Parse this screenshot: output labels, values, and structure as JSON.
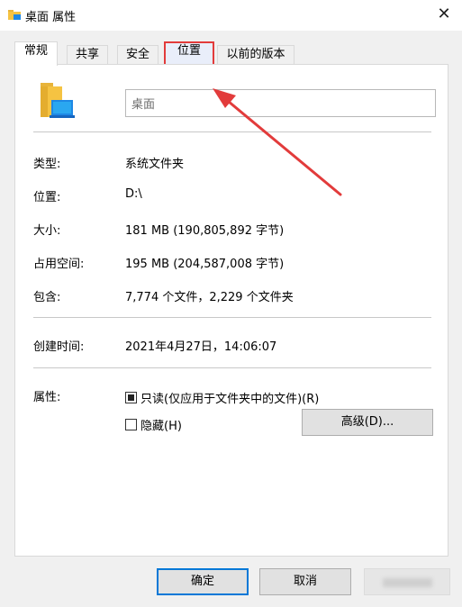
{
  "window": {
    "title": "桌面 属性",
    "close_glyph": "✕"
  },
  "tabs": [
    {
      "label": "常规",
      "active": true
    },
    {
      "label": "共享",
      "active": false
    },
    {
      "label": "安全",
      "active": false
    },
    {
      "label": "位置",
      "active": false,
      "highlighted": true
    },
    {
      "label": "以前的版本",
      "active": false
    }
  ],
  "general": {
    "name": "桌面",
    "properties": [
      {
        "label": "类型:",
        "value": "系统文件夹"
      },
      {
        "label": "位置:",
        "value": "D:\\"
      },
      {
        "label": "大小:",
        "value": "181 MB (190,805,892 字节)"
      },
      {
        "label": "占用空间:",
        "value": "195 MB (204,587,008 字节)"
      },
      {
        "label": "包含:",
        "value": "7,774 个文件，2,229 个文件夹"
      }
    ],
    "created": {
      "label": "创建时间:",
      "value": "2021年4月27日，14:06:07"
    },
    "attributes": {
      "label": "属性:",
      "readonly_label": "只读(仅应用于文件夹中的文件)(R)",
      "readonly_state": "indeterminate",
      "hidden_label": "隐藏(H)",
      "hidden_checked": false,
      "advanced_label": "高级(D)..."
    }
  },
  "footer": {
    "ok_label": "确定",
    "cancel_label": "取消"
  },
  "colors": {
    "highlight": "#e23b3b",
    "accent": "#0078d7",
    "folder": "#f5c342"
  }
}
